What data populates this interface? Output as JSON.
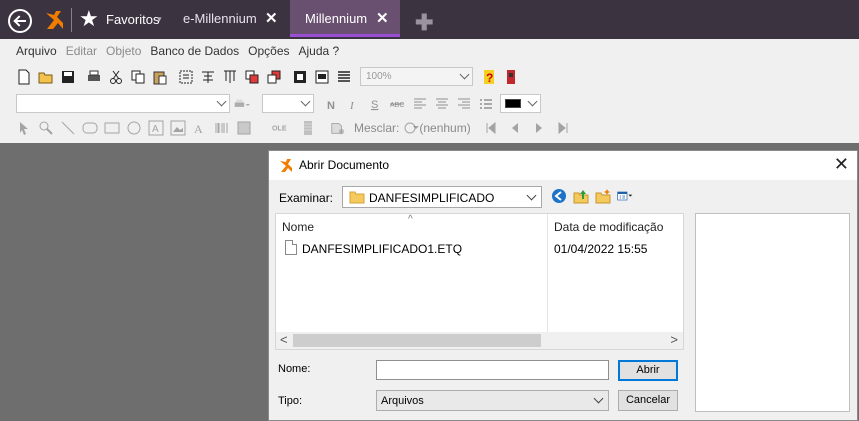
{
  "topbar": {
    "favorites_label": "Favoritos",
    "tabs": [
      {
        "label": "e-Millennium",
        "close": "✕"
      },
      {
        "label": "Millennium",
        "close": "✕"
      }
    ],
    "add_tab": "✚"
  },
  "menu": {
    "items": [
      "Arquivo",
      "Editar",
      "Objeto",
      "Banco de Dados",
      "Opções",
      "Ajuda ?"
    ]
  },
  "toolbar": {
    "zoom_value": "100%",
    "merge_label": "Mesclar:",
    "merge_value": "(nenhum)",
    "color_swatch": "#000000"
  },
  "dialog": {
    "title": "Abrir Documento",
    "close": "✕",
    "look_in_label": "Examinar:",
    "look_in_value": "DANFESIMPLIFICADO",
    "columns": {
      "name": "Nome",
      "date": "Data de modificação"
    },
    "files": [
      {
        "name": "DANFESIMPLIFICADO1.ETQ",
        "modified": "01/04/2022 15:55"
      }
    ],
    "scroll_left": "<",
    "scroll_right": ">",
    "file_name_label": "Nome:",
    "file_name_value": "",
    "file_type_label": "Tipo:",
    "file_type_value": "Arquivos",
    "open_button": "Abrir",
    "cancel_button": "Cancelar"
  },
  "colors": {
    "topbar_bg": "#3c3340",
    "active_tab_underline": "#9b4fd4",
    "brand_orange": "#f07d00",
    "workspace_bg": "#6e6e6e",
    "default_button_border": "#0078d7"
  }
}
